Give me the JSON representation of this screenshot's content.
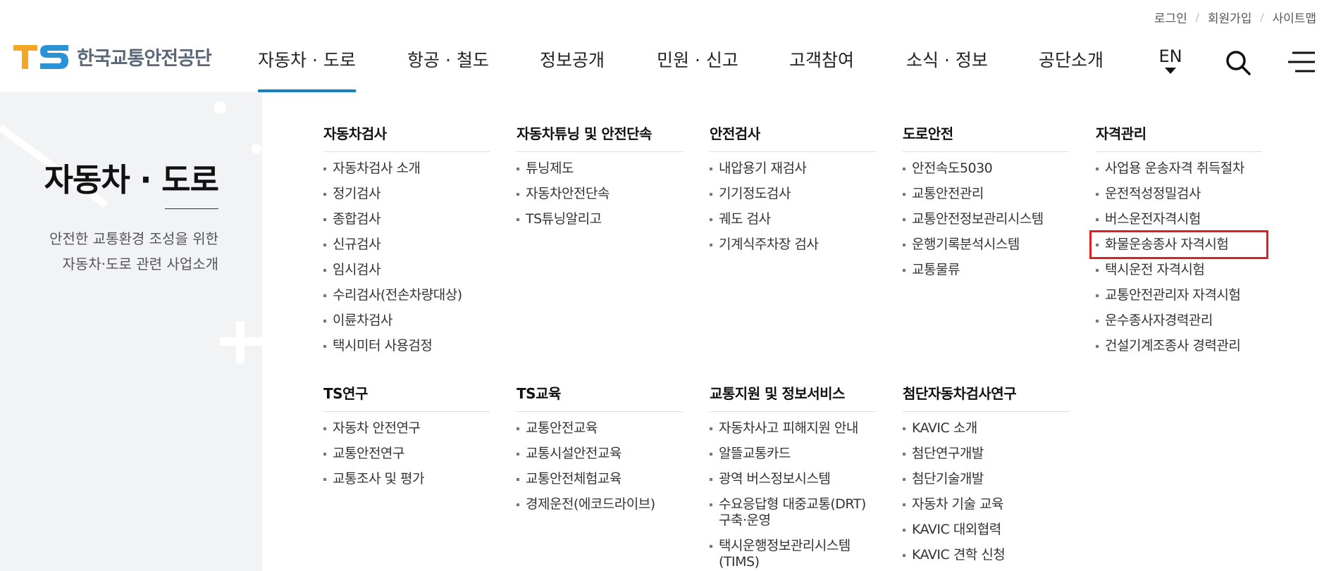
{
  "util_links": [
    "로그인",
    "회원가입",
    "사이트맵"
  ],
  "logo": {
    "mark": "TS",
    "name": "한국교통안전공단"
  },
  "gnb": [
    "자동차 · 도로",
    "항공 · 철도",
    "정보공개",
    "민원 · 신고",
    "고객참여",
    "소식 · 정보",
    "공단소개"
  ],
  "lang": "EN",
  "icons": {
    "search": "search-icon",
    "menu": "hamburger-menu-icon",
    "lang_caret": "caret-down-icon"
  },
  "colors": {
    "accent": "#1a7fbf",
    "highlight_box": "#e02020",
    "logo_orange": "#f5a623",
    "logo_blue": "#2a93d5"
  },
  "side": {
    "title": "자동차 · 도로",
    "desc1": "안전한 교통환경 조성을 위한",
    "desc2": "자동차·도로 관련 사업소개"
  },
  "menu": [
    {
      "title": "자동차검사",
      "items": [
        "자동차검사 소개",
        "정기검사",
        "종합검사",
        "신규검사",
        "임시검사",
        "수리검사(전손차량대상)",
        "이륜차검사",
        "택시미터 사용검정"
      ]
    },
    {
      "title": "자동차튜닝 및 안전단속",
      "items": [
        "튜닝제도",
        "자동차안전단속",
        "TS튜닝알리고"
      ]
    },
    {
      "title": "안전검사",
      "items": [
        "내압용기 재검사",
        "기기정도검사",
        "궤도 검사",
        "기계식주차장 검사"
      ]
    },
    {
      "title": "도로안전",
      "items": [
        "안전속도5030",
        "교통안전관리",
        "교통안전정보관리시스템",
        "운행기록분석시스템",
        "교통물류"
      ]
    },
    {
      "title": "자격관리",
      "items": [
        "사업용 운송자격 취득절차",
        "운전적성정밀검사",
        "버스운전자격시험",
        "화물운송종사 자격시험",
        "택시운전 자격시험",
        "교통안전관리자 자격시험",
        "운수종사자경력관리",
        "건설기계조종사 경력관리"
      ]
    },
    {
      "title": "TS연구",
      "items": [
        "자동차 안전연구",
        "교통안전연구",
        "교통조사 및 평가"
      ]
    },
    {
      "title": "TS교육",
      "items": [
        "교통안전교육",
        "교통시설안전교육",
        "교통안전체험교육",
        "경제운전(에코드라이브)"
      ]
    },
    {
      "title": "교통지원 및 정보서비스",
      "items": [
        "자동차사고 피해지원 안내",
        "알뜰교통카드",
        "광역 버스정보시스템",
        "수요응답형 대중교통(DRT) 구축·운영",
        "택시운행정보관리시스템 (TIMS)"
      ]
    },
    {
      "title": "첨단자동차검사연구",
      "items": [
        "KAVIC 소개",
        "첨단연구개발",
        "첨단기술개발",
        "자동차 기술 교육",
        "KAVIC 대외협력",
        "KAVIC 견학 신청"
      ]
    }
  ]
}
